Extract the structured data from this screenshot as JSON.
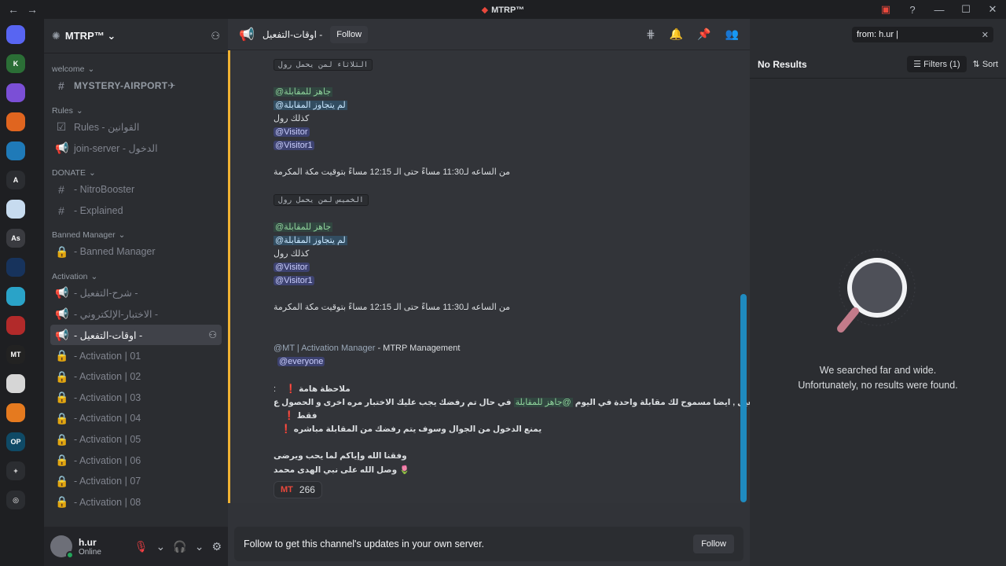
{
  "app": {
    "title": "MTRP™",
    "nav_back": "←",
    "nav_forward": "→",
    "window_controls": [
      "monitor-icon",
      "help-icon",
      "minimize-icon",
      "maximize-icon",
      "close-icon"
    ]
  },
  "guilds": [
    {
      "label": "",
      "color": "#5865f2"
    },
    {
      "label": "K",
      "color": "#2b6e36"
    },
    {
      "label": "",
      "color": "#7b4fd6"
    },
    {
      "label": "",
      "color": "#e0651f"
    },
    {
      "label": "",
      "color": "#1f7ab8"
    },
    {
      "label": "A",
      "color": "#2b2d31"
    },
    {
      "label": "",
      "color": "#c7dbef"
    },
    {
      "label": "As",
      "color": "#3a3b40"
    },
    {
      "label": "",
      "color": "#17335c"
    },
    {
      "label": "",
      "color": "#2aa3c8"
    },
    {
      "label": "",
      "color": "#b22a2a"
    },
    {
      "label": "MT",
      "color": "#222"
    },
    {
      "label": "",
      "color": "#d6d6d6"
    },
    {
      "label": "",
      "color": "#e57a1f"
    },
    {
      "label": "OP",
      "color": "#0f4a66"
    },
    {
      "label": "+",
      "color": "#2b2d31"
    },
    {
      "label": "◎",
      "color": "#2b2d31"
    }
  ],
  "server": {
    "name": "MTRP™",
    "categories": [
      {
        "name": "welcome",
        "channels": [
          {
            "icon": "#",
            "label": "MYSTERY-AIRPORT✈",
            "bold": true
          }
        ]
      },
      {
        "name": "Rules",
        "channels": [
          {
            "icon": "☑",
            "label": "Rules - القوانين"
          },
          {
            "icon": "📢",
            "label": "join-server - الدخول"
          }
        ]
      },
      {
        "name": "DONATE",
        "channels": [
          {
            "icon": "#",
            "label": "- NitroBooster"
          },
          {
            "icon": "#",
            "label": "- Explained"
          }
        ]
      },
      {
        "name": "Banned Manager",
        "channels": [
          {
            "icon": "🔒",
            "label": "- Banned Manager"
          }
        ]
      },
      {
        "name": "Activation",
        "channels": [
          {
            "icon": "📢",
            "label": "- شرح-التفعيل -"
          },
          {
            "icon": "📢",
            "label": "- الاختبار-الإلكتروني -"
          },
          {
            "icon": "📢",
            "label": "- اوقات-التفعيل -",
            "active": true
          },
          {
            "icon": "🔒",
            "label": "- Activation | 01"
          },
          {
            "icon": "🔒",
            "label": "- Activation | 02"
          },
          {
            "icon": "🔒",
            "label": "- Activation | 03"
          },
          {
            "icon": "🔒",
            "label": "- Activation | 04"
          },
          {
            "icon": "🔒",
            "label": "- Activation | 05"
          },
          {
            "icon": "🔒",
            "label": "- Activation | 06"
          },
          {
            "icon": "🔒",
            "label": "- Activation | 07"
          },
          {
            "icon": "🔒",
            "label": "- Activation | 08"
          }
        ]
      }
    ]
  },
  "user": {
    "name": "h.ur",
    "status": "Online"
  },
  "channel": {
    "name": "اوقات-التفعيل -",
    "follow_label": "Follow"
  },
  "messages": {
    "tue_header": "الثلاثاء لمن يحمل رول",
    "thu_header": "الخميس لمن يحمل رول",
    "role_ready": "@جاهز للمقابلة",
    "role_passed": "@لم يتجاوز المقابلة",
    "also_role": "كذلك رول",
    "visitor": "@Visitor",
    "visitor1": "@Visitor1",
    "time_line": "من الساعه لـ11:30 مساءً حتى الـ 12:15 مساءً بتوقيت مكة المكرمة",
    "author_line": "@MT | Activation Manager",
    "author_suffix": " - MTRP Management",
    "everyone": "@everyone",
    "note_title": "ملاحظة هامة",
    "note_colon": ":",
    "note_1": "في حال تم رفضك يجب عليك الاختبار مره اخرى و الحصول ع",
    "note_1_role": "@جاهز للمقابلة",
    "note_1_end": "ليتم دخولك للتفعيل , ايضا مسموح لك مقابلة واحدة في اليوم",
    "note_2": "فقط",
    "note_3": "يمنع الدخول من الجوال وسوف يتم رفضك من المقابلة مباشره",
    "closing_1": "وفقنا الله وإياكم لما يحب ويرضى",
    "closing_2": "وصل الله على نبي الهدى محمد 🌷",
    "reaction_emoji": "MT",
    "reaction_count": "266"
  },
  "followbar": {
    "text": "Follow to get this channel's updates in your own server.",
    "button": "Follow"
  },
  "search": {
    "query": "from: h.ur",
    "results_title": "No Results",
    "filters_label": "Filters (1)",
    "sort_label": "Sort",
    "empty_line1": "We searched far and wide.",
    "empty_line2": "Unfortunately, no results were found."
  }
}
